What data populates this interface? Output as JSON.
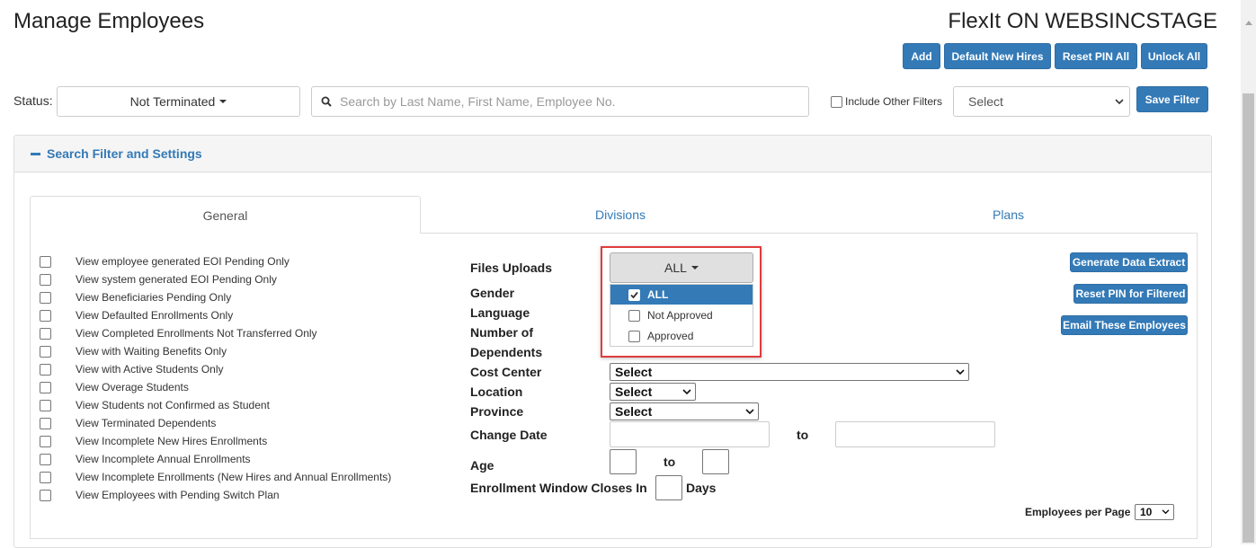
{
  "header": {
    "page_title": "Manage Employees",
    "app_title": "FlexIt ON WEBSINCSTAGE"
  },
  "toolbar": {
    "add": "Add",
    "default_new_hires": "Default New Hires",
    "reset_pin_all": "Reset PIN All",
    "unlock_all": "Unlock All",
    "save_filter": "Save Filter"
  },
  "search": {
    "status_label": "Status:",
    "status_value": "Not Terminated",
    "placeholder": "Search by Last Name, First Name, Employee No.",
    "include_other_filters": "Include Other Filters",
    "filter_select": "Select"
  },
  "panel": {
    "title": "Search Filter and Settings"
  },
  "tabs": [
    {
      "label": "General"
    },
    {
      "label": "Divisions"
    },
    {
      "label": "Plans"
    }
  ],
  "options": [
    "View employee generated EOI Pending Only",
    "View system generated EOI Pending Only",
    "View Beneficiaries Pending Only",
    "View Defaulted Enrollments Only",
    "View Completed Enrollments Not Transferred Only",
    "View with Waiting Benefits Only",
    "View with Active Students Only",
    "View Overage Students",
    "View Students not Confirmed as Student",
    "View Terminated Dependents",
    "View Incomplete New Hires Enrollments",
    "View Incomplete Annual Enrollments",
    "View Incomplete Enrollments (New Hires and Annual Enrollments)",
    "View Employees with Pending Switch Plan"
  ],
  "filters": {
    "files_uploads": "Files Uploads",
    "gender": "Gender",
    "language": "Language",
    "number_of": "Number of",
    "dependents": "Dependents",
    "cost_center": "Cost Center",
    "cost_center_value": "Select",
    "location": "Location",
    "location_value": "Select",
    "province": "Province",
    "province_value": "Select",
    "change_date": "Change Date",
    "to": "to",
    "age": "Age",
    "enrollment_window": "Enrollment Window Closes In",
    "days": "Days"
  },
  "files_dropdown": {
    "selected": "ALL",
    "options": [
      {
        "label": "ALL",
        "checked": true
      },
      {
        "label": "Not Approved",
        "checked": false
      },
      {
        "label": "Approved",
        "checked": false
      }
    ]
  },
  "actions": {
    "generate_data_extract": "Generate Data Extract",
    "reset_pin_filtered": "Reset PIN for Filtered",
    "email_employees": "Email These Employees"
  },
  "paging": {
    "label": "Employees per Page",
    "value": "10"
  },
  "colors": {
    "primary": "#337ab7",
    "highlight": "#e03c3c"
  }
}
